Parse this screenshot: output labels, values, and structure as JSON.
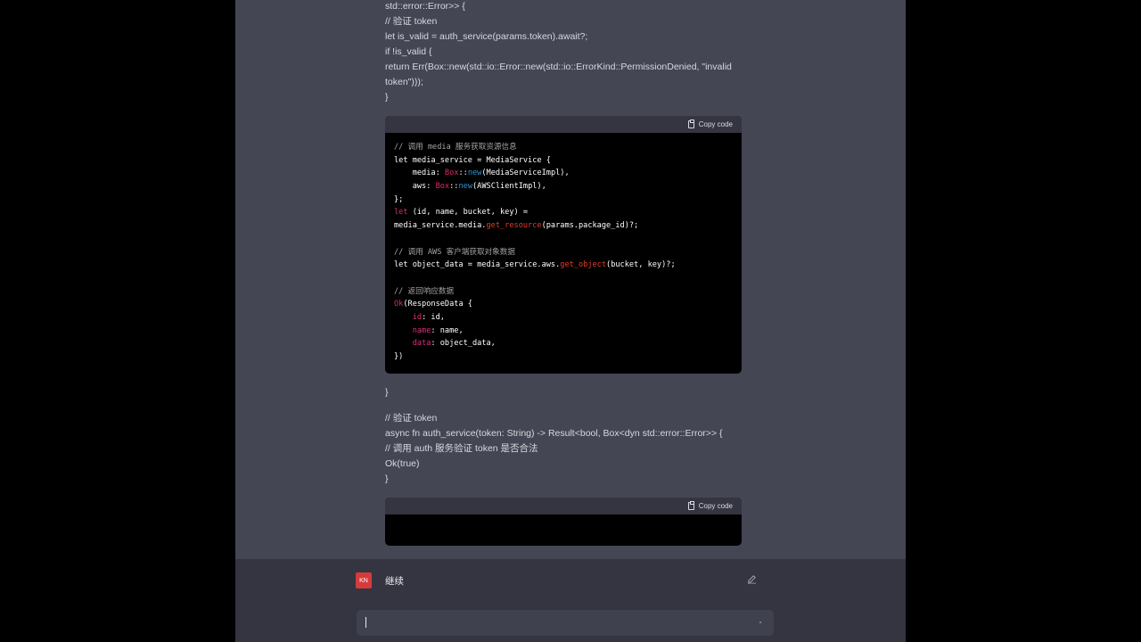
{
  "text_lines": {
    "l1": "std::error::Error>> {",
    "l2": "// 验证 token",
    "l3": "let is_valid = auth_service(params.token).await?;",
    "l4": "if !is_valid {",
    "l5": "return Err(Box::new(std::io::Error::new(std::io::ErrorKind::PermissionDenied, \"invalid",
    "l6": "token\")));",
    "l7": "}",
    "l8": "}",
    "l9": "// 验证 token",
    "l10": "async fn auth_service(token: String) -> Result<bool, Box<dyn std::error::Error>> {",
    "l11": "// 调用 auth 服务验证 token 是否合法",
    "l12": "Ok(true)",
    "l13": "}"
  },
  "code_block_1": {
    "copy_label": "Copy code",
    "lines": [
      [
        {
          "t": "// 调用 media 服务获取资源信息",
          "c": "cmt"
        }
      ],
      [
        {
          "t": "let media_service = MediaService {",
          "c": ""
        }
      ],
      [
        {
          "t": "    media: ",
          "c": ""
        },
        {
          "t": "Box",
          "c": "kw"
        },
        {
          "t": "::",
          "c": ""
        },
        {
          "t": "new",
          "c": "ty"
        },
        {
          "t": "(MediaServiceImpl),",
          "c": ""
        }
      ],
      [
        {
          "t": "    aws: ",
          "c": ""
        },
        {
          "t": "Box",
          "c": "kw"
        },
        {
          "t": "::",
          "c": ""
        },
        {
          "t": "new",
          "c": "ty"
        },
        {
          "t": "(AWSClientImpl),",
          "c": ""
        }
      ],
      [
        {
          "t": "};",
          "c": ""
        }
      ],
      [
        {
          "t": "let",
          "c": "kw"
        },
        {
          "t": " (id, name, bucket, key) =",
          "c": ""
        }
      ],
      [
        {
          "t": "media_service.media.",
          "c": ""
        },
        {
          "t": "get_resource",
          "c": "fn"
        },
        {
          "t": "(params.package_id)?;",
          "c": ""
        }
      ],
      [
        {
          "t": "",
          "c": ""
        }
      ],
      [
        {
          "t": "// 调用 AWS 客户端获取对象数据",
          "c": "cmt"
        }
      ],
      [
        {
          "t": "let object_data = media_service.aws.",
          "c": ""
        },
        {
          "t": "get_object",
          "c": "fn"
        },
        {
          "t": "(bucket, key)?;",
          "c": ""
        }
      ],
      [
        {
          "t": "",
          "c": ""
        }
      ],
      [
        {
          "t": "// 返回响应数据",
          "c": "cmt"
        }
      ],
      [
        {
          "t": "Ok",
          "c": "kw"
        },
        {
          "t": "(ResponseData {",
          "c": ""
        }
      ],
      [
        {
          "t": "    ",
          "c": ""
        },
        {
          "t": "id",
          "c": "pr"
        },
        {
          "t": ": id,",
          "c": ""
        }
      ],
      [
        {
          "t": "    ",
          "c": ""
        },
        {
          "t": "name",
          "c": "pr"
        },
        {
          "t": ": name,",
          "c": ""
        }
      ],
      [
        {
          "t": "    ",
          "c": ""
        },
        {
          "t": "data",
          "c": "pr"
        },
        {
          "t": ": object_data,",
          "c": ""
        }
      ],
      [
        {
          "t": "})",
          "c": ""
        }
      ]
    ]
  },
  "code_block_2": {
    "copy_label": "Copy code",
    "lines": []
  },
  "user_message": {
    "avatar_initials": "KN",
    "text": "继续"
  },
  "colors": {
    "assistant_bg": "#444654",
    "user_bg": "#343541",
    "code_bg": "#000000",
    "avatar": "#d73a3a"
  }
}
